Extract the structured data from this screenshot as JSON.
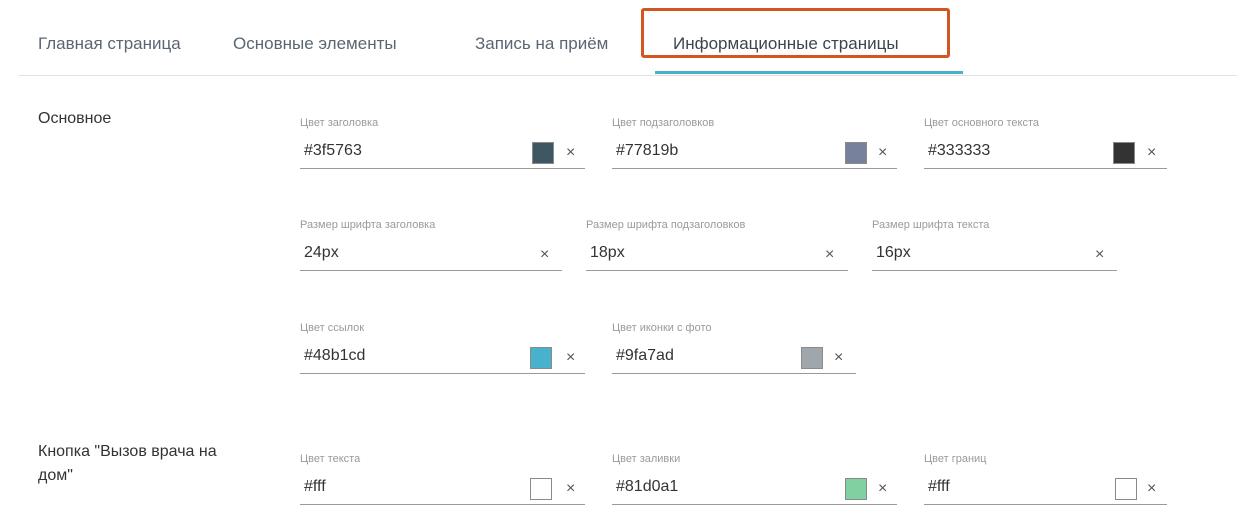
{
  "tabs": [
    {
      "label": "Главная страница"
    },
    {
      "label": "Основные элементы"
    },
    {
      "label": "Запись на приём"
    },
    {
      "label": "Информационные страницы",
      "active": true
    }
  ],
  "sections": {
    "main": {
      "label": "Основное",
      "title_color": {
        "label": "Цвет заголовка",
        "value": "#3f5763",
        "swatch": "#3f5763"
      },
      "subtitle_color": {
        "label": "Цвет подзаголовков",
        "value": "#77819b",
        "swatch": "#77819b"
      },
      "text_color": {
        "label": "Цвет основного текста",
        "value": "#333333",
        "swatch": "#333333"
      },
      "title_size": {
        "label": "Размер шрифта заголовка",
        "value": "24px"
      },
      "subtitle_size": {
        "label": "Размер шрифта подзаголовков",
        "value": "18px"
      },
      "text_size": {
        "label": "Размер шрифта текста",
        "value": "16px"
      },
      "link_color": {
        "label": "Цвет ссылок",
        "value": "#48b1cd",
        "swatch": "#48b1cd"
      },
      "photo_icon_color": {
        "label": "Цвет иконки с фото",
        "value": "#9fa7ad",
        "swatch": "#9fa7ad"
      }
    },
    "doctor_button": {
      "label": "Кнопка \"Вызов врача на дом\"",
      "text_color": {
        "label": "Цвет текста",
        "value": "#fff",
        "swatch": "#ffffff"
      },
      "fill_color": {
        "label": "Цвет заливки",
        "value": "#81d0a1",
        "swatch": "#81d0a1"
      },
      "border_color": {
        "label": "Цвет границ",
        "value": "#fff",
        "swatch": "#ffffff"
      }
    }
  },
  "clear_symbol": "×",
  "colors": {
    "accent": "#48b1cd",
    "highlight": "#d2561e"
  }
}
